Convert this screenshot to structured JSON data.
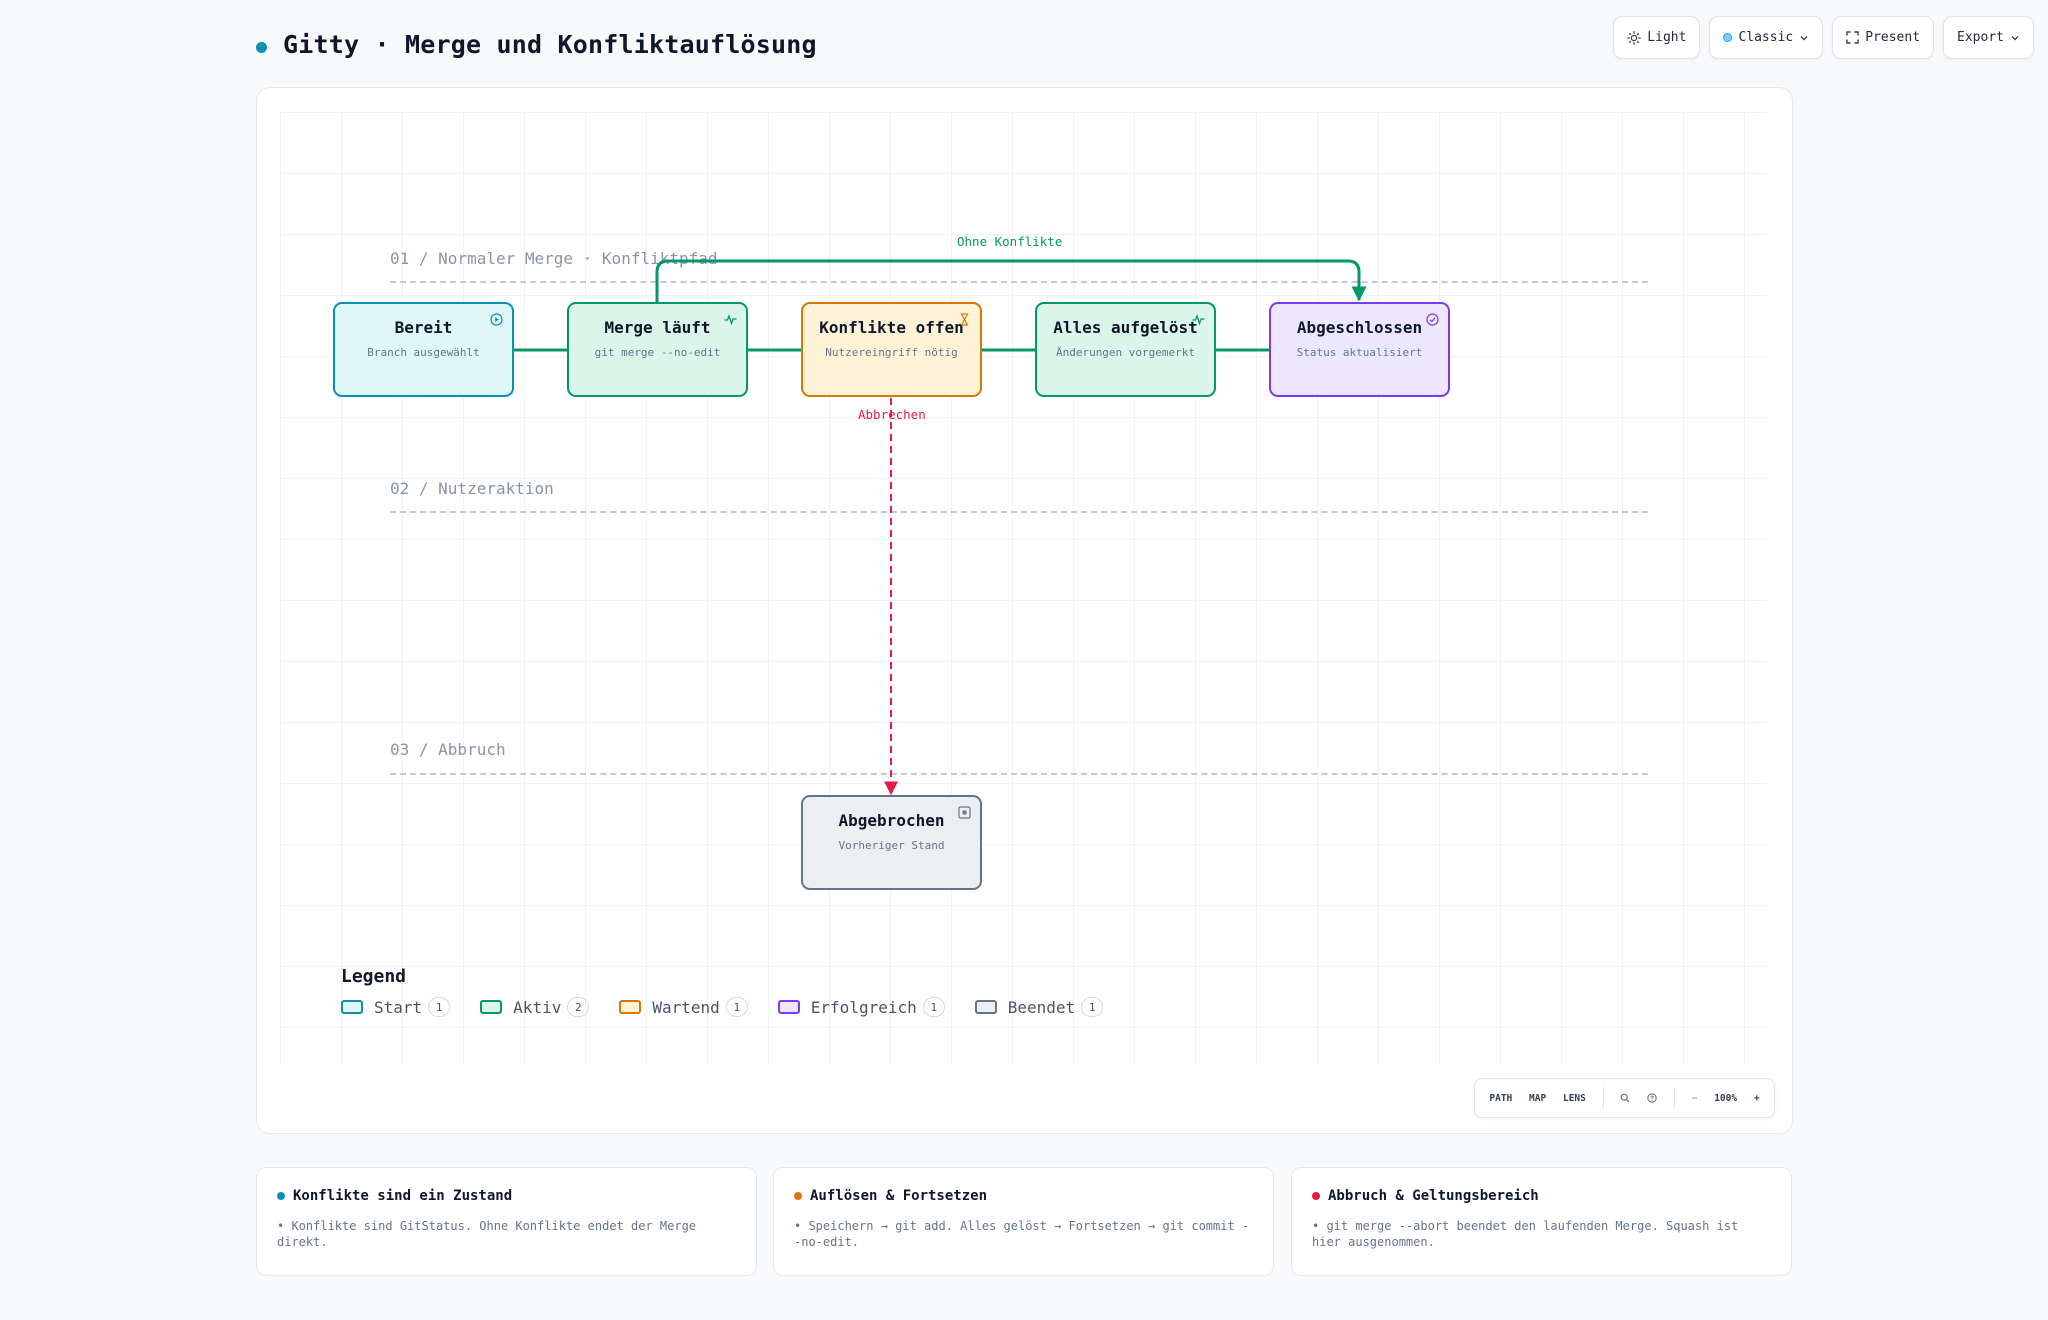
{
  "header": {
    "title": "Gitty · Merge und Konfliktauflösung"
  },
  "toolbar": {
    "theme_label": "Light",
    "style_label": "Classic",
    "present_label": "Present",
    "export_label": "Export"
  },
  "lanes": [
    {
      "label": "01 / Normaler Merge · Konfliktpfad"
    },
    {
      "label": "02 / Nutzeraktion"
    },
    {
      "label": "03 / Abbruch"
    }
  ],
  "nodes": [
    {
      "id": "bereit",
      "title": "Bereit",
      "subtitle": "Branch ausgewählt",
      "category": "Start",
      "icon": "play-circle-icon"
    },
    {
      "id": "merge",
      "title": "Merge läuft",
      "subtitle": "git merge --no-edit",
      "category": "Aktiv",
      "icon": "activity-icon"
    },
    {
      "id": "konflikte",
      "title": "Konflikte offen",
      "subtitle": "Nutzereingriff nötig",
      "category": "Wartend",
      "icon": "hourglass-icon"
    },
    {
      "id": "geloest",
      "title": "Alles aufgelöst",
      "subtitle": "Änderungen vorgemerkt",
      "category": "Aktiv",
      "icon": "activity-icon"
    },
    {
      "id": "abgeschlossen",
      "title": "Abgeschlossen",
      "subtitle": "Status aktualisiert",
      "category": "Erfolgreich",
      "icon": "check-circle-icon"
    },
    {
      "id": "abgebrochen",
      "title": "Abgebrochen",
      "subtitle": "Vorheriger Stand",
      "category": "Beendet",
      "icon": "stop-square-icon"
    }
  ],
  "edges": [
    {
      "from": "bereit",
      "to": "merge",
      "label": ""
    },
    {
      "from": "merge",
      "to": "konflikte",
      "label": ""
    },
    {
      "from": "konflikte",
      "to": "geloest",
      "label": ""
    },
    {
      "from": "geloest",
      "to": "abgeschlossen",
      "label": ""
    },
    {
      "from": "merge",
      "to": "abgeschlossen",
      "label": "Ohne Konflikte"
    },
    {
      "from": "konflikte",
      "to": "abgebrochen",
      "label": "Abbrechen"
    }
  ],
  "colors": {
    "start": {
      "fill": "#e0f7fa",
      "stroke": "#0891b2"
    },
    "aktiv": {
      "fill": "#dcf5ea",
      "stroke": "#059669"
    },
    "wartend": {
      "fill": "#fef3d6",
      "stroke": "#d97706"
    },
    "erfolgreich": {
      "fill": "#ede7fd",
      "stroke": "#7c3aed"
    },
    "beendet": {
      "fill": "#eceef2",
      "stroke": "#64748b"
    },
    "success_edge": "#059669",
    "abort_edge": "#e11d48"
  },
  "legend": {
    "title": "Legend",
    "items": [
      {
        "label": "Start",
        "count": "1"
      },
      {
        "label": "Aktiv",
        "count": "2"
      },
      {
        "label": "Wartend",
        "count": "1"
      },
      {
        "label": "Erfolgreich",
        "count": "1"
      },
      {
        "label": "Beendet",
        "count": "1"
      }
    ]
  },
  "mini_toolbar": {
    "path": "PATH",
    "map": "MAP",
    "lens": "LENS",
    "zoom_out": "−",
    "zoom_level": "100%",
    "zoom_in": "+"
  },
  "cards": [
    {
      "title": "Konflikte sind ein Zustand",
      "text": "• Konflikte sind GitStatus. Ohne Konflikte endet der Merge direkt.",
      "color": "#0891b2"
    },
    {
      "title": "Auflösen & Fortsetzen",
      "text": "• Speichern → git add. Alles gelöst → Fortsetzen → git commit --no-edit.",
      "color": "#d97706"
    },
    {
      "title": "Abbruch & Geltungsbereich",
      "text": "• git merge --abort beendet den laufenden Merge. Squash ist hier ausgenommen.",
      "color": "#e11d48"
    }
  ]
}
